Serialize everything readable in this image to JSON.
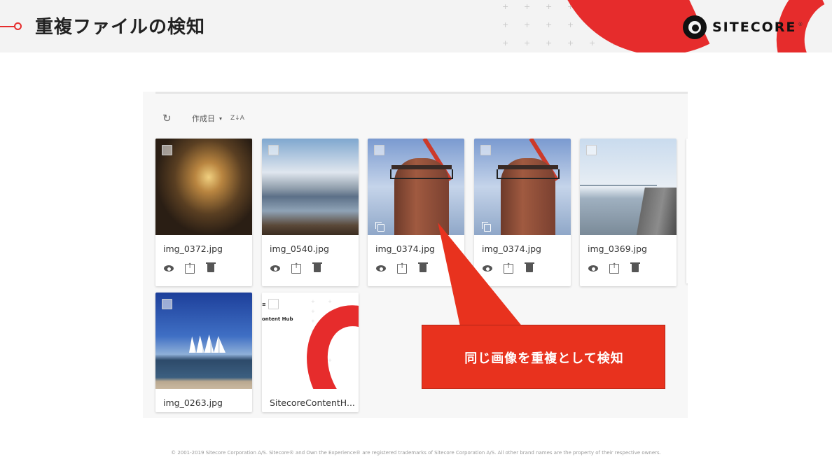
{
  "header": {
    "title": "重複ファイルの検知",
    "brand": "SITECORE",
    "brand_mark": "®",
    "accent_color": "#e62c2c"
  },
  "toolbar": {
    "refresh_icon": "refresh-icon",
    "sort_label": "作成日",
    "sort_caret": "▾",
    "sort_order_icon": "Z↓A"
  },
  "assets": [
    {
      "filename": "img_0372.jpg",
      "image": "tunnel-runners",
      "duplicate": false
    },
    {
      "filename": "img_0540.jpg",
      "image": "lake-mount-fuji",
      "duplicate": false
    },
    {
      "filename": "img_0374.jpg",
      "image": "brick-windmill-tower",
      "duplicate": true
    },
    {
      "filename": "img_0374.jpg",
      "image": "brick-windmill-tower",
      "duplicate": true
    },
    {
      "filename": "img_0369.jpg",
      "image": "bridge-seaside-walkway",
      "duplicate": false
    },
    {
      "filename": "img_0263.jpg",
      "image": "harbor-sailship",
      "duplicate": false
    },
    {
      "filename": "SitecoreContentH...",
      "image": "content-hub-document",
      "duplicate": false
    }
  ],
  "doc_thumb": {
    "label": "ontent Hub",
    "cut_text": "≡"
  },
  "callout": {
    "text": "同じ画像を重複として検知",
    "color": "#e8321e"
  },
  "footer": {
    "copyright": "© 2001-2019 Sitecore Corporation A/S. Sitecore® and Own the Experience® are registered trademarks of Sitecore Corporation A/S. All other brand names are the property of their respective owners."
  }
}
